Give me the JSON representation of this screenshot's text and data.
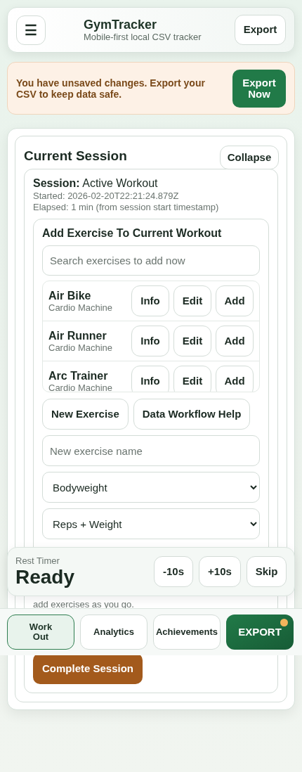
{
  "header": {
    "menu_icon": "☰",
    "title": "GymTracker",
    "subtitle": "Mobile-first local CSV tracker",
    "export_button": "Export"
  },
  "banner": {
    "message": "You have unsaved changes. Export your CSV to keep data safe.",
    "button": "Export Now"
  },
  "session_panel": {
    "title": "Current Session",
    "collapse_button": "Collapse",
    "session_label": "Session:",
    "session_name": "Active Workout",
    "started": "Started: 2026-02-20T22:21:24.879Z",
    "elapsed": "Elapsed: 1 min (from session start timestamp)",
    "add_exercise": {
      "title": "Add Exercise To Current Workout",
      "search_placeholder": "Search exercises to add now",
      "exercises": [
        {
          "name": "Air Bike",
          "category": "Cardio Machine",
          "actions": [
            "Info",
            "Edit",
            "Add"
          ]
        },
        {
          "name": "Air Runner",
          "category": "Cardio Machine",
          "actions": [
            "Info",
            "Edit",
            "Add"
          ]
        },
        {
          "name": "Arc Trainer",
          "category": "Cardio Machine",
          "actions": [
            "Info",
            "Edit",
            "Add"
          ]
        }
      ],
      "buttons": [
        "New Exercise",
        "Data Workflow Help"
      ],
      "name_placeholder": "New exercise name",
      "equipment_select": "Bodyweight",
      "tracking_select": "Reps + Weight"
    },
    "empty_note": "add exercises as you go.",
    "complete_button": "Complete Session"
  },
  "rest_timer": {
    "label": "Rest Timer",
    "status": "Ready",
    "buttons": [
      "-10s",
      "+10s",
      "Skip"
    ]
  },
  "bottom_nav": [
    {
      "label": "Work Out",
      "kind": "tab",
      "selected": true
    },
    {
      "label": "Analytics",
      "kind": "tab",
      "selected": false
    },
    {
      "label": "Achievements",
      "kind": "tab",
      "selected": false
    },
    {
      "label": "EXPORT",
      "kind": "action",
      "notification": true
    }
  ]
}
